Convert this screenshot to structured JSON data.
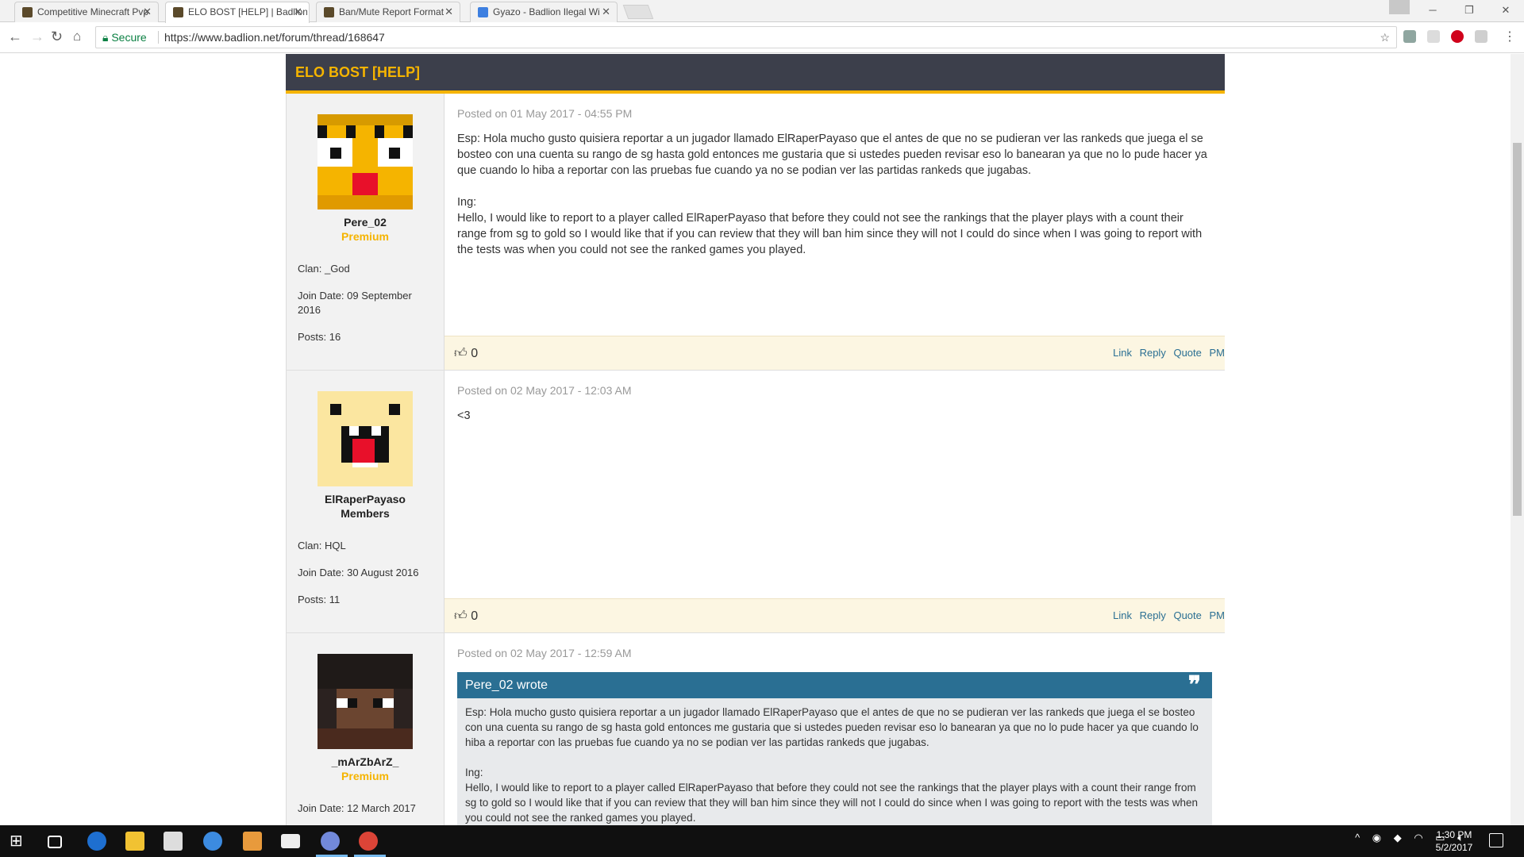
{
  "browser": {
    "tabs": [
      {
        "title": "Competitive Minecraft Pvp",
        "icon": "badlion-favicon-icon",
        "active": false
      },
      {
        "title": "ELO BOST [HELP] | Badlion",
        "icon": "badlion-favicon-icon",
        "active": true
      },
      {
        "title": "Ban/Mute Report Format",
        "icon": "badlion-favicon-icon",
        "active": false
      },
      {
        "title": "Gyazo - Badlion Ilegal Wi",
        "icon": "gyazo-favicon-icon",
        "active": false
      }
    ],
    "secure_label": "Secure",
    "url": "https://www.badlion.net/forum/thread/168647"
  },
  "thread": {
    "title": "ELO BOST [HELP]"
  },
  "posts": [
    {
      "username": "Pere_02",
      "rank": "Premium",
      "clan": "Clan: _God",
      "join_date": "Join Date: 09 September 2016",
      "posts": "Posts: 16",
      "posted_on": "Posted on 01 May 2017 - 04:55 PM",
      "paragraphs": [
        "Esp: Hola mucho gusto quisiera reportar a un jugador llamado ElRaperPayaso que el antes de que no se pudieran ver las rankeds que juega el se bosteo con una cuenta su rango de sg hasta gold entonces me gustaria que si ustedes pueden revisar eso lo banearan ya que no lo pude hacer ya que cuando lo hiba a reportar con las pruebas fue cuando ya no se podian ver las partidas rankeds que jugabas.",
        "Ing:",
        "Hello, I would like to report to a player called ElRaperPayaso that before they could not see the rankings that the player plays with a count their range from sg to gold so I would like that if you can review that they will ban him since they will not I could do since when I was going to report with the tests was when you could not see the ranked games you played."
      ],
      "likes": "0"
    },
    {
      "username": "ElRaperPayaso",
      "rank": "Members",
      "clan": "Clan: HQL",
      "join_date": "Join Date: 30 August 2016",
      "posts": "Posts: 11",
      "posted_on": "Posted on 02 May 2017 - 12:03 AM",
      "text": "<3",
      "likes": "0"
    },
    {
      "username": "_mArZbArZ_",
      "rank": "Premium",
      "join_date": "Join Date: 12 March 2017",
      "posted_on": "Posted on 02 May 2017 - 12:59 AM",
      "quote": {
        "author": "Pere_02 wrote",
        "paragraphs": [
          "Esp: Hola mucho gusto quisiera reportar a un jugador llamado ElRaperPayaso que el antes de que no se pudieran ver las rankeds que juega el se bosteo con una cuenta su rango de sg hasta gold entonces me gustaria que si ustedes pueden revisar eso lo banearan ya que no lo pude hacer ya que cuando lo hiba a reportar con las pruebas fue cuando ya no se podian ver las partidas rankeds que jugabas.",
          "Ing:",
          "Hello, I would like to report to a player called ElRaperPayaso that before they could not see the rankings that the player plays with a count their range from sg to gold so I would like that if you can review that they will ban him since they will not I could do since when I was going to report with the tests was when you could not see the ranked games you played."
        ]
      }
    }
  ],
  "post_actions": {
    "link": "Link",
    "reply": "Reply",
    "quote": "Quote",
    "pm": "PM"
  },
  "taskbar": {
    "time": "1:30 PM",
    "date": "5/2/2017"
  },
  "colors": {
    "accent": "#f5b400",
    "header_bg": "#3c3f4b",
    "link": "#2a6f93",
    "footer_bg": "#fcf6e2"
  }
}
